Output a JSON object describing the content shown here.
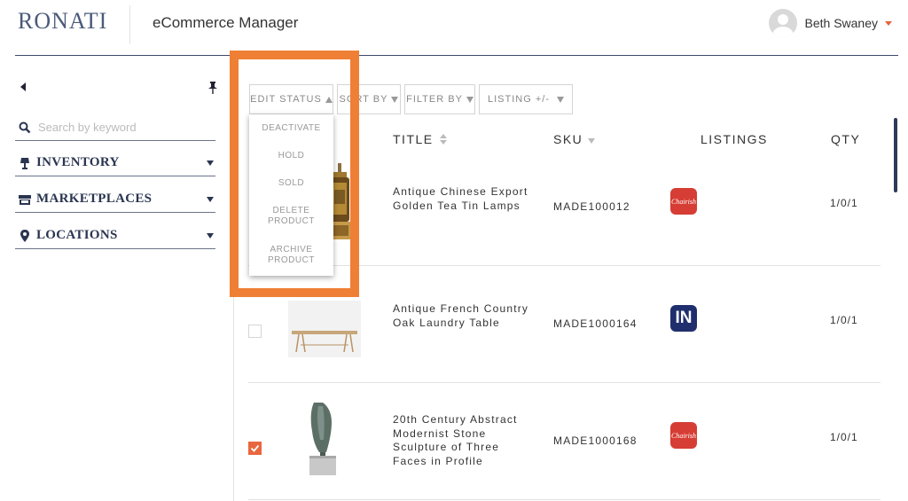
{
  "header": {
    "logo": "RONATI",
    "app_title": "eCommerce Manager",
    "user_name": "Beth Swaney"
  },
  "sidebar": {
    "search_placeholder": "Search by keyword",
    "items": [
      {
        "label": "INVENTORY",
        "icon": "lamp-icon"
      },
      {
        "label": "MARKETPLACES",
        "icon": "store-icon"
      },
      {
        "label": "LOCATIONS",
        "icon": "map-pin-icon"
      }
    ]
  },
  "toolbar": {
    "edit_status": "EDIT STATUS",
    "sort_by": "SORT BY",
    "filter_by": "FILTER BY",
    "listing": "LISTING +/-"
  },
  "dropdown": {
    "items": [
      "DEACTIVATE",
      "HOLD",
      "SOLD",
      "DELETE PRODUCT",
      "ARCHIVE PRODUCT"
    ]
  },
  "table": {
    "columns": {
      "title": "TITLE",
      "sku": "SKU",
      "listings": "LISTINGS",
      "qty": "QTY"
    },
    "rows": [
      {
        "title": "Antique Chinese Export Golden Tea Tin Lamps",
        "sku": "MADE100012",
        "listing": "chairish-icon",
        "badge_text": "Chairish",
        "qty": "1/0/1",
        "checked": false
      },
      {
        "title": "Antique French Country Oak Laundry Table",
        "sku": "MADE1000164",
        "listing": "incollect-icon",
        "badge_text": "IN",
        "qty": "1/0/1",
        "checked": false
      },
      {
        "title": "20th Century Abstract Modernist Stone Sculpture of Three Faces in Profile",
        "sku": "MADE1000168",
        "listing": "chairish-icon",
        "badge_text": "Chairish",
        "qty": "1/0/1",
        "checked": true
      }
    ]
  },
  "colors": {
    "accent": "#ef7f35",
    "brand_navy": "#3d4a6a",
    "checkbox_checked": "#e9673f",
    "chairish_red": "#d63d34",
    "incollect_navy": "#1f2f6d"
  }
}
